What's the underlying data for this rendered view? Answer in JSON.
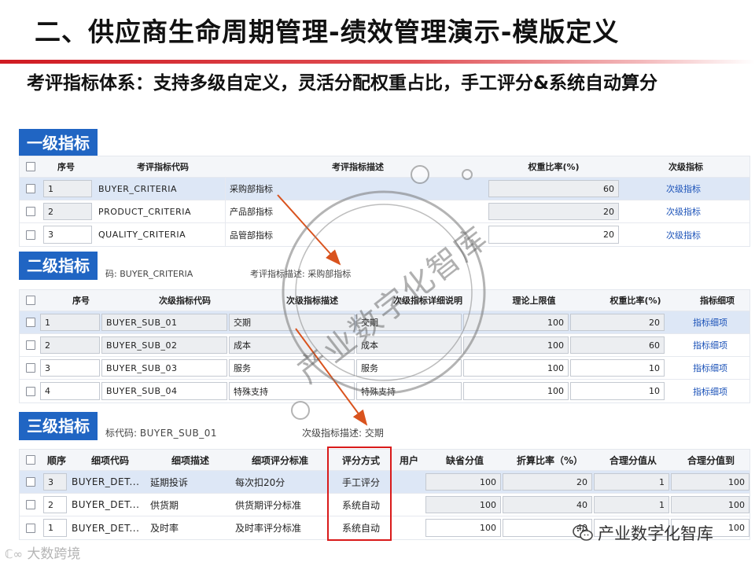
{
  "title": "二、供应商生命周期管理-绩效管理演示-模版定义",
  "subtitle": "考评指标体系：支持多级自定义，灵活分配权重占比，手工评分&系统自动算分",
  "colors": {
    "accent_blue": "#2065c3",
    "title_rule": "#d01b22",
    "highlight": "#d91a1a",
    "link": "#1b52b8"
  },
  "level1": {
    "label": "一级指标",
    "headers": {
      "seq": "序号",
      "code": "考评指标代码",
      "desc": "考评指标描述",
      "weight": "权重比率(%)",
      "sub": "次级指标"
    },
    "rows": [
      {
        "seq": "1",
        "code": "BUYER_CRITERIA",
        "desc": "采购部指标",
        "weight": "60",
        "sub": "次级指标"
      },
      {
        "seq": "2",
        "code": "PRODUCT_CRITERIA",
        "desc": "产品部指标",
        "weight": "20",
        "sub": "次级指标"
      },
      {
        "seq": "3",
        "code": "QUALITY_CRITERIA",
        "desc": "品管部指标",
        "weight": "20",
        "sub": "次级指标"
      }
    ]
  },
  "level2": {
    "label": "二级指标",
    "info_code_label": "码:",
    "info_code_value": "BUYER_CRITERIA",
    "info_desc_label": "考评指标描述:",
    "info_desc_value": "采购部指标",
    "headers": {
      "seq": "序号",
      "code": "次级指标代码",
      "desc": "次级指标描述",
      "detail_desc": "次级指标详细说明",
      "upper": "理论上限值",
      "weight": "权重比率(%)",
      "detail": "指标细项"
    },
    "rows": [
      {
        "seq": "1",
        "code": "BUYER_SUB_01",
        "desc": "交期",
        "detail_desc": "交期",
        "upper": "100",
        "weight": "20",
        "detail": "指标细项"
      },
      {
        "seq": "2",
        "code": "BUYER_SUB_02",
        "desc": "成本",
        "detail_desc": "成本",
        "upper": "100",
        "weight": "60",
        "detail": "指标细项"
      },
      {
        "seq": "3",
        "code": "BUYER_SUB_03",
        "desc": "服务",
        "detail_desc": "服务",
        "upper": "100",
        "weight": "10",
        "detail": "指标细项"
      },
      {
        "seq": "4",
        "code": "BUYER_SUB_04",
        "desc": "特殊支持",
        "detail_desc": "特殊支持",
        "upper": "100",
        "weight": "10",
        "detail": "指标细项"
      }
    ]
  },
  "level3": {
    "label": "三级指标",
    "info_code_label": "标代码:",
    "info_code_value": "BUYER_SUB_01",
    "info_desc_label": "次级指标描述:",
    "info_desc_value": "交期",
    "headers": {
      "seq": "顺序",
      "code": "细项代码",
      "desc": "细项描述",
      "standard": "细项评分标准",
      "method": "评分方式",
      "user": "用户",
      "default": "缺省分值",
      "rate": "折算比率（%）",
      "from": "合理分值从",
      "to": "合理分值到"
    },
    "rows": [
      {
        "seq": "3",
        "code": "BUYER_DET...",
        "desc": "延期投诉",
        "standard": "每次扣20分",
        "method": "手工评分",
        "default": "100",
        "rate": "20",
        "from": "1",
        "to": "100"
      },
      {
        "seq": "2",
        "code": "BUYER_DET...",
        "desc": "供货期",
        "standard": "供货期评分标准",
        "method": "系统自动",
        "default": "100",
        "rate": "40",
        "from": "1",
        "to": "100"
      },
      {
        "seq": "1",
        "code": "BUYER_DET...",
        "desc": "及时率",
        "standard": "及时率评分标准",
        "method": "系统自动",
        "default": "100",
        "rate": "40",
        "from": "1",
        "to": "100"
      }
    ]
  },
  "watermark": {
    "text": "产业数字化智库"
  },
  "logos": {
    "left": "大数跨境",
    "right": "产业数字化智库"
  }
}
